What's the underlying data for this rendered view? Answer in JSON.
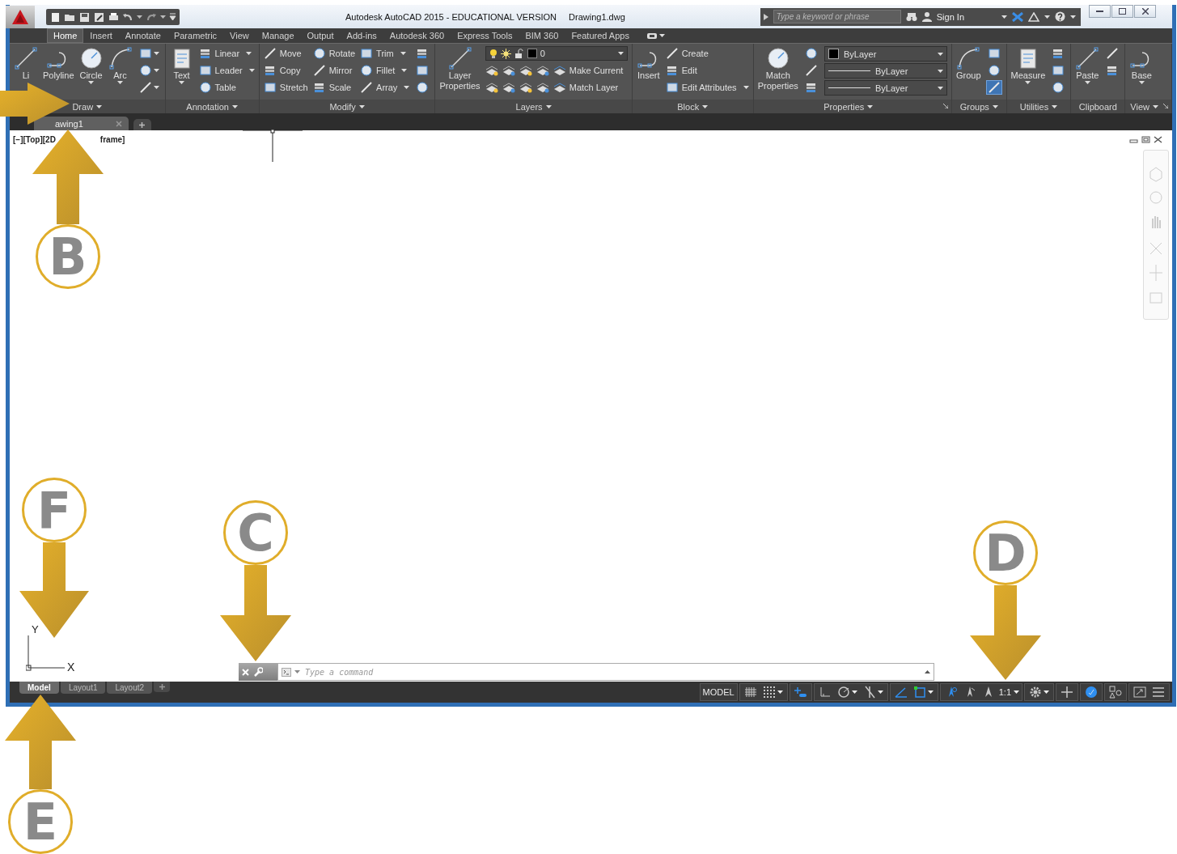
{
  "title_bar": {
    "app_title": "Autodesk AutoCAD 2015 - EDUCATIONAL VERSION",
    "file_name": "Drawing1.dwg",
    "search": {
      "placeholder": "Type a keyword or phrase"
    },
    "sign_in": "Sign In"
  },
  "ribbon_tabs": [
    {
      "label": "Home",
      "selected": true
    },
    {
      "label": "Insert",
      "selected": false
    },
    {
      "label": "Annotate",
      "selected": false
    },
    {
      "label": "Parametric",
      "selected": false
    },
    {
      "label": "View",
      "selected": false
    },
    {
      "label": "Manage",
      "selected": false
    },
    {
      "label": "Output",
      "selected": false
    },
    {
      "label": "Add-ins",
      "selected": false
    },
    {
      "label": "Autodesk 360",
      "selected": false
    },
    {
      "label": "Express Tools",
      "selected": false
    },
    {
      "label": "BIM 360",
      "selected": false
    },
    {
      "label": "Featured Apps",
      "selected": false
    }
  ],
  "panels": [
    {
      "title": "Draw",
      "menu": true,
      "launcher": false,
      "columns": [
        {
          "kind": "large",
          "label": "Li",
          "dropdown": false
        },
        {
          "kind": "large",
          "label": "Polyline",
          "dropdown": false
        },
        {
          "kind": "large",
          "label": "Circle",
          "dropdown": true
        },
        {
          "kind": "large",
          "label": "Arc",
          "dropdown": true
        },
        {
          "kind": "icons",
          "items": [
            {
              "dropdown": true,
              "on": false
            },
            {
              "dropdown": true,
              "on": false
            },
            {
              "dropdown": true,
              "on": false
            }
          ]
        }
      ]
    },
    {
      "title": "Annotation",
      "menu": true,
      "launcher": false,
      "columns": [
        {
          "kind": "large",
          "label": "Text",
          "dropdown": true
        },
        {
          "kind": "stack",
          "items": [
            {
              "label": "Linear",
              "dropdown": true
            },
            {
              "label": "Leader",
              "dropdown": true
            },
            {
              "label": "Table",
              "dropdown": false
            }
          ]
        }
      ]
    },
    {
      "title": "Modify",
      "menu": true,
      "launcher": false,
      "columns": [
        {
          "kind": "stack",
          "items": [
            {
              "label": "Move",
              "dropdown": false
            },
            {
              "label": "Copy",
              "dropdown": false
            },
            {
              "label": "Stretch",
              "dropdown": false
            }
          ]
        },
        {
          "kind": "stack",
          "items": [
            {
              "label": "Rotate",
              "dropdown": false
            },
            {
              "label": "Mirror",
              "dropdown": false
            },
            {
              "label": "Scale",
              "dropdown": false
            }
          ]
        },
        {
          "kind": "stack",
          "items": [
            {
              "label": "Trim",
              "dropdown": true
            },
            {
              "label": "Fillet",
              "dropdown": true
            },
            {
              "label": "Array",
              "dropdown": true
            }
          ]
        },
        {
          "kind": "icons",
          "items": [
            {
              "dropdown": false,
              "on": false
            },
            {
              "dropdown": false,
              "on": false
            },
            {
              "dropdown": false,
              "on": false
            }
          ]
        }
      ]
    },
    {
      "title": "Layers",
      "menu": true,
      "launcher": false,
      "columns": [
        {
          "kind": "large",
          "label": "Layer Properties",
          "dropdown": false
        },
        {
          "kind": "layer_block",
          "value": "0",
          "items": [
            {
              "label": "Make Current"
            },
            {
              "label": "Match Layer"
            }
          ]
        }
      ]
    },
    {
      "title": "Block",
      "menu": true,
      "launcher": false,
      "columns": [
        {
          "kind": "large",
          "label": "Insert",
          "dropdown": false
        },
        {
          "kind": "stack",
          "items": [
            {
              "label": "Create",
              "dropdown": false
            },
            {
              "label": "Edit",
              "dropdown": false
            },
            {
              "label": "Edit Attributes",
              "dropdown": true
            }
          ]
        }
      ]
    },
    {
      "title": "Properties",
      "menu": true,
      "launcher": true,
      "columns": [
        {
          "kind": "large",
          "label": "Match Properties",
          "dropdown": false
        },
        {
          "kind": "icons",
          "items": [
            {
              "dropdown": false,
              "on": false
            },
            {
              "dropdown": false,
              "on": false
            },
            {
              "dropdown": false,
              "on": false
            }
          ]
        },
        {
          "kind": "combos",
          "items": [
            {
              "kind": "color",
              "value": "ByLayer"
            },
            {
              "kind": "line",
              "value": "ByLayer"
            },
            {
              "kind": "line",
              "value": "ByLayer"
            }
          ]
        }
      ]
    },
    {
      "title": "Groups",
      "menu": true,
      "launcher": false,
      "columns": [
        {
          "kind": "large",
          "label": "Group",
          "dropdown": false
        },
        {
          "kind": "icons",
          "items": [
            {
              "dropdown": false,
              "on": false
            },
            {
              "dropdown": false,
              "on": false
            },
            {
              "dropdown": false,
              "on": true
            }
          ]
        }
      ]
    },
    {
      "title": "Utilities",
      "menu": true,
      "launcher": false,
      "columns": [
        {
          "kind": "large",
          "label": "Measure",
          "dropdown": true
        },
        {
          "kind": "icons",
          "items": [
            {
              "dropdown": false,
              "on": false
            },
            {
              "dropdown": false,
              "on": false
            },
            {
              "dropdown": false,
              "on": false
            }
          ]
        }
      ]
    },
    {
      "title": "Clipboard",
      "menu": false,
      "launcher": false,
      "columns": [
        {
          "kind": "large",
          "label": "Paste",
          "dropdown": true
        },
        {
          "kind": "icons",
          "items": [
            {
              "dropdown": false,
              "on": false
            },
            {
              "dropdown": false,
              "on": false
            }
          ]
        }
      ]
    },
    {
      "title": "View",
      "menu": true,
      "launcher": true,
      "columns": [
        {
          "kind": "large",
          "label": "Base",
          "dropdown": true
        }
      ]
    }
  ],
  "file_tabs": [
    {
      "label": "awing1",
      "selected": true
    }
  ],
  "viewport_label": {
    "left": "[−][Top][2D",
    "right": "frame]"
  },
  "ucs": {
    "y": "Y",
    "x": "X"
  },
  "command_line": {
    "placeholder": "Type a command"
  },
  "layout_tabs": [
    {
      "label": "Model",
      "selected": true
    },
    {
      "label": "Layout1",
      "selected": false
    },
    {
      "label": "Layout2",
      "selected": false
    }
  ],
  "status_bar": {
    "model": "MODEL",
    "groups": [
      {
        "items": [
          {
            "kind": "toggle",
            "on": false,
            "dropdown": false
          },
          {
            "kind": "toggle",
            "on": false,
            "dropdown": true
          }
        ]
      },
      {
        "items": [
          {
            "kind": "toggle",
            "on": true,
            "dropdown": false
          }
        ]
      },
      {
        "items": [
          {
            "kind": "toggle",
            "on": false,
            "dropdown": false
          },
          {
            "kind": "toggle",
            "on": false,
            "dropdown": true
          },
          {
            "kind": "toggle",
            "on": false,
            "dropdown": true
          }
        ]
      },
      {
        "items": [
          {
            "kind": "toggle",
            "on": true,
            "dropdown": false
          },
          {
            "kind": "toggle",
            "on": true,
            "dropdown": true
          }
        ]
      },
      {
        "items": [
          {
            "kind": "toggle",
            "on": true,
            "dropdown": false
          },
          {
            "kind": "toggle",
            "on": false,
            "dropdown": false
          },
          {
            "kind": "toggle",
            "on": false,
            "dropdown": false
          },
          {
            "kind": "text",
            "label": "1:1",
            "dropdown": true
          }
        ]
      },
      {
        "items": [
          {
            "kind": "toggle",
            "on": false,
            "dropdown": true
          }
        ]
      },
      {
        "items": [
          {
            "kind": "toggle",
            "on": false,
            "dropdown": false
          }
        ]
      },
      {
        "items": [
          {
            "kind": "toggle",
            "on": true,
            "dropdown": false
          }
        ]
      },
      {
        "items": [
          {
            "kind": "toggle",
            "on": false,
            "dropdown": false
          }
        ]
      },
      {
        "items": [
          {
            "kind": "toggle",
            "on": false,
            "dropdown": false
          },
          {
            "kind": "toggle",
            "on": false,
            "dropdown": false
          }
        ]
      }
    ]
  },
  "callouts": [
    {
      "kind": "arrow"
    },
    {
      "kind": "badge",
      "label": "B"
    },
    {
      "kind": "badge",
      "label": "F"
    },
    {
      "kind": "badge",
      "label": "C"
    },
    {
      "kind": "badge",
      "label": "D"
    },
    {
      "kind": "badge",
      "label": "E"
    }
  ]
}
